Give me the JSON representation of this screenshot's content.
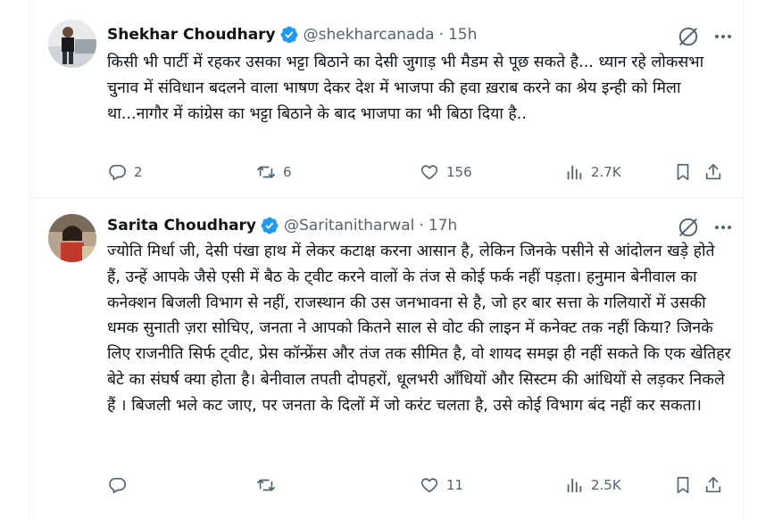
{
  "tweets": [
    {
      "author_name": "Shekhar Choudhary",
      "handle": "@shekharcanada",
      "separator": "·",
      "time": "15h",
      "text": "किसी भी पार्टी में रहकर उसका भट्टा बिठाने का देसी जुगाड़ भी मैडम से पूछ सकते है... ध्यान रहे लोकसभा चुनाव में संविधान बदलने वाला भाषण देकर देश में भाजपा की हवा ख़राब करने का श्रेय इन्ही को मिला था...नागौर में कांग्रेस का भट्टा बिठाने के बाद भाजपा का भी बिठा दिया है..",
      "replies": "2",
      "reposts": "6",
      "likes": "156",
      "views": "2.7K"
    },
    {
      "author_name": "Sarita Choudhary",
      "handle": "@Saritanitharwal",
      "separator": "·",
      "time": "17h",
      "text": "ज्योति मिर्धा जी, देसी पंखा हाथ में लेकर कटाक्ष करना आसान है, लेकिन जिनके पसीने से आंदोलन खड़े होते हैं, उन्हें आपके जैसे एसी में बैठ के ट्वीट करने वालों के तंज से कोई फर्क नहीं पड़ता। हनुमान बेनीवाल का कनेक्शन बिजली विभाग से नहीं, राजस्थान की उस जनभावना से है, जो हर बार सत्ता के गलियारों में उसकी धमक सुनाती  ज़रा सोचिए, जनता ने आपको कितने साल से वोट की लाइन में कनेक्ट तक नहीं किया? जिनके लिए राजनीति सिर्फ ट्वीट, प्रेस कॉन्फ्रेंस और तंज तक सीमित है, वो शायद समझ ही नहीं सकते कि एक खेतिहर बेटे का संघर्ष क्या होता है। बेनीवाल तपती दोपहरों, धूलभरी आँधियों और सिस्टम की आंधियों से लड़कर निकले हैं । बिजली भले कट जाए, पर जनता के दिलों में जो करंट चलता है, उसे कोई विभाग बंद नहीं कर सकता।",
      "replies": "",
      "reposts": "",
      "likes": "11",
      "views": "2.5K"
    }
  ],
  "colors": {
    "verified": "#1d9bf0",
    "muted": "#536471",
    "text": "#0f1419",
    "border": "#eff3f4"
  },
  "icons": [
    "verified-badge-icon",
    "grok-icon",
    "more-icon",
    "reply-icon",
    "repost-icon",
    "like-icon",
    "views-icon",
    "bookmark-icon",
    "share-icon"
  ]
}
